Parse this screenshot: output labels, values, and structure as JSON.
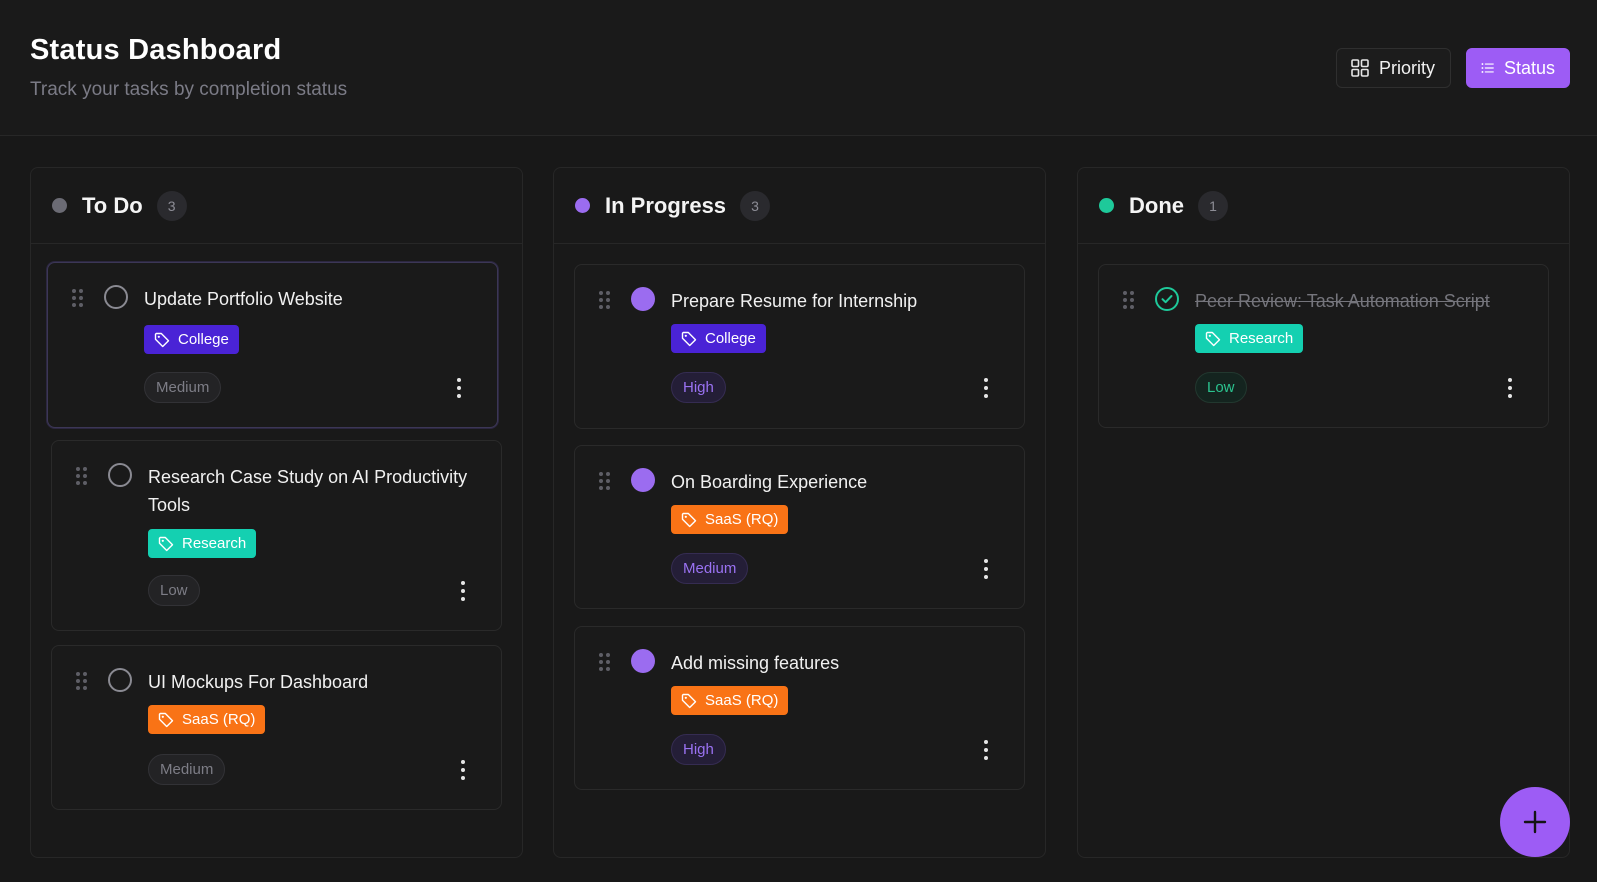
{
  "header": {
    "title": "Status Dashboard",
    "subtitle": "Track your tasks by completion status",
    "view_buttons": {
      "priority": "Priority",
      "status": "Status"
    },
    "active_view": "Status"
  },
  "colors": {
    "accent": "#9d5cf5",
    "todo": "#6b6b74",
    "in_progress": "#9b6cf0",
    "done": "#1ec99a",
    "tag_college": "#4a23d6",
    "tag_research": "#14d0b1",
    "tag_saas": "#f97316"
  },
  "columns": [
    {
      "title": "To Do",
      "count": "3",
      "cards": [
        {
          "title": "Update Portfolio Website",
          "tag": "College",
          "priority": "Medium"
        },
        {
          "title": "Research Case Study on AI Productivity Tools",
          "tag": "Research",
          "priority": "Low"
        },
        {
          "title": "UI Mockups For Dashboard",
          "tag": "SaaS (RQ)",
          "priority": "Medium"
        }
      ]
    },
    {
      "title": "In Progress",
      "count": "3",
      "cards": [
        {
          "title": "Prepare Resume for Internship",
          "tag": "College",
          "priority": "High"
        },
        {
          "title": "On Boarding Experience",
          "tag": "SaaS (RQ)",
          "priority": "Medium"
        },
        {
          "title": "Add missing features",
          "tag": "SaaS (RQ)",
          "priority": "High"
        }
      ]
    },
    {
      "title": "Done",
      "count": "1",
      "cards": [
        {
          "title": "Peer Review: Task Automation Script",
          "tag": "Research",
          "priority": "Low"
        }
      ]
    }
  ],
  "icons": {
    "priority_view": "grid-icon",
    "status_view": "list-icon",
    "tag": "tag-icon",
    "drag": "drag-handle-icon",
    "more": "more-vertical-icon",
    "add": "plus-icon"
  }
}
